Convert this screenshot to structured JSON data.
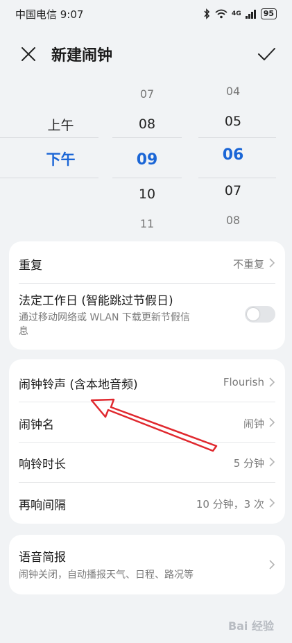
{
  "status_bar": {
    "carrier_time": "中国电信 9:07",
    "network": "4G",
    "battery": "95"
  },
  "header": {
    "title": "新建闹钟"
  },
  "picker": {
    "ampm": [
      "上午",
      "下午"
    ],
    "ampm_selected": "下午",
    "hours": [
      "07",
      "08",
      "09",
      "10",
      "11"
    ],
    "hour_selected": "09",
    "minutes": [
      "04",
      "05",
      "06",
      "07",
      "08"
    ],
    "minute_selected": "06"
  },
  "card1": {
    "repeat_label": "重复",
    "repeat_value": "不重复",
    "workday_label": "法定工作日 (智能跳过节假日)",
    "workday_sub_line1": "通过移动网络或 WLAN 下载更新节假信",
    "workday_sub_line2": "息"
  },
  "card2": {
    "ringtone_label": "闹钟铃声 (含本地音频)",
    "ringtone_value": "Flourish",
    "name_label": "闹钟名",
    "name_value": "闹钟",
    "duration_label": "响铃时长",
    "duration_value": "5 分钟",
    "snooze_label": "再响间隔",
    "snooze_value": "10 分钟，3 次"
  },
  "card3": {
    "voice_label": "语音简报",
    "voice_sub": "闹钟关闭，自动播报天气、日程、路况等"
  },
  "watermark": "Bai 经验",
  "colors": {
    "accent": "#1b66d6",
    "annotation_arrow": "#e0282e"
  }
}
